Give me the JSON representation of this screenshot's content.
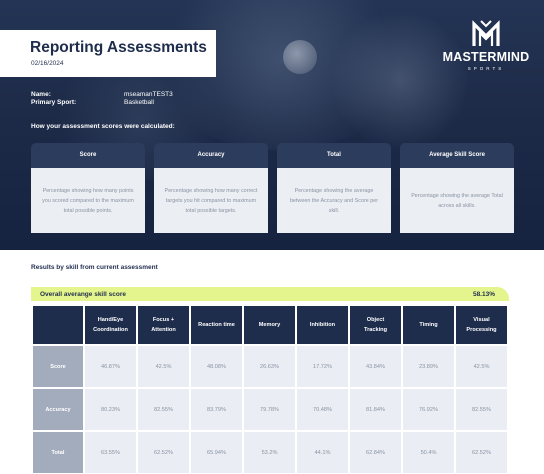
{
  "header": {
    "title": "Reporting Assessments",
    "date": "02/16/2024"
  },
  "logo": {
    "brand": "MASTERMIND",
    "sub": "SPORTS"
  },
  "profile": {
    "name_label": "Name:",
    "name_value": "mseamanTEST3",
    "sport_label": "Primary Sport:",
    "sport_value": "Basketball"
  },
  "calc_heading": "How your assessment scores were calculated:",
  "explanations": [
    {
      "title": "Score",
      "text": "Percentage showing how many points you scored compared to the maximum total possible points."
    },
    {
      "title": "Accuracy",
      "text": "Percentage showing how many correct targets you hit compared to maximum total possible targets."
    },
    {
      "title": "Total",
      "text": "Percentage showing the average between the Accuracy and Score per skill."
    },
    {
      "title": "Average Skill Score",
      "text": "Percentage showing the average Total across all skills."
    }
  ],
  "results": {
    "heading": "Results by skill from current assessment",
    "overall_label": "Overall averange skill score",
    "overall_value": "58.13%",
    "skills": [
      "Hand/Eye Coordination",
      "Focus + Attention",
      "Reaction time",
      "Memory",
      "Inhibition",
      "Object Tracking",
      "Timing",
      "Visual Processing"
    ],
    "rows": [
      {
        "label": "Score",
        "values": [
          "46.87%",
          "42.5%",
          "48.08%",
          "26.63%",
          "17.72%",
          "43.84%",
          "23.89%",
          "42.5%"
        ]
      },
      {
        "label": "Accuracy",
        "values": [
          "80.23%",
          "82.55%",
          "83.79%",
          "79.78%",
          "70.48%",
          "81.84%",
          "76.92%",
          "82.55%"
        ]
      },
      {
        "label": "Total",
        "values": [
          "63.55%",
          "62.52%",
          "65.94%",
          "53.2%",
          "44.1%",
          "62.84%",
          "50.4%",
          "62.52%"
        ]
      }
    ]
  },
  "colors": {
    "navy": "#1f2d4d",
    "accent_lime": "#e4f58e",
    "row_header": "#a3acbc",
    "cell_bg": "#eaeef4"
  }
}
